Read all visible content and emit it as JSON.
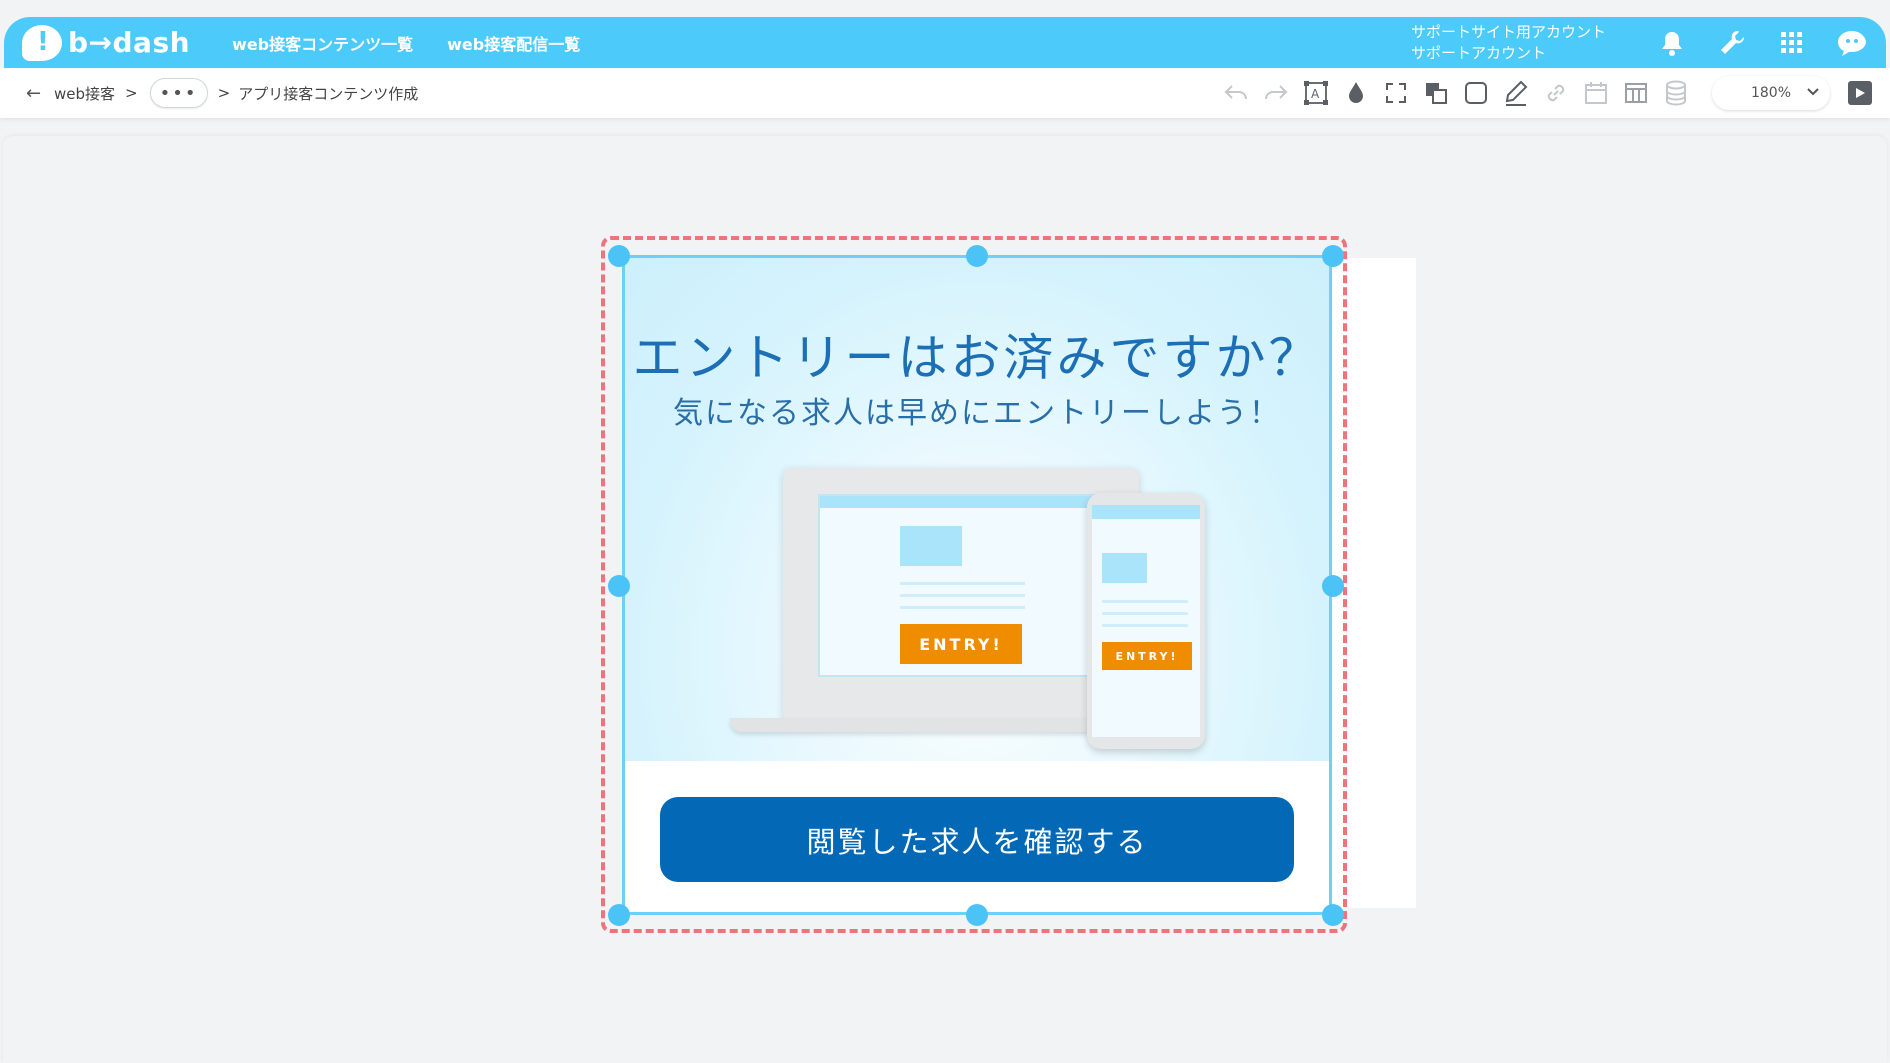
{
  "header": {
    "logo_text": "b→dash",
    "nav": [
      "web接客コンテンツ一覧",
      "web接客配信一覧"
    ],
    "account_line1": "サポートサイト用アカウント",
    "account_line2": "サポートアカウント",
    "icons": [
      "bell-icon",
      "wrench-icon",
      "apps-grid-icon",
      "user-avatar-icon"
    ]
  },
  "breadcrumb": {
    "root": "web接客",
    "sep": ">",
    "more": "•••",
    "current": "アプリ接客コンテンツ作成"
  },
  "toolbar": {
    "tools": [
      "undo-icon",
      "redo-icon",
      "text-frame-icon",
      "fill-color-icon",
      "fullscreen-icon",
      "layer-icon",
      "rectangle-icon",
      "pen-icon",
      "link-icon",
      "calendar-icon",
      "table-icon",
      "database-icon"
    ],
    "zoom": "180%"
  },
  "popup": {
    "headline": "エントリーはお済みですか？",
    "subline": "気になる求人は早めにエントリーしよう！",
    "entry_label": "ENTRY!",
    "cta_label": "閲覧した求人を確認する"
  },
  "colors": {
    "header_bg": "#4ccbfb",
    "cta_bg": "#0369b6",
    "selection_dash": "#f0727a",
    "handle": "#4cc3f7",
    "entry_orange": "#f08c00"
  }
}
